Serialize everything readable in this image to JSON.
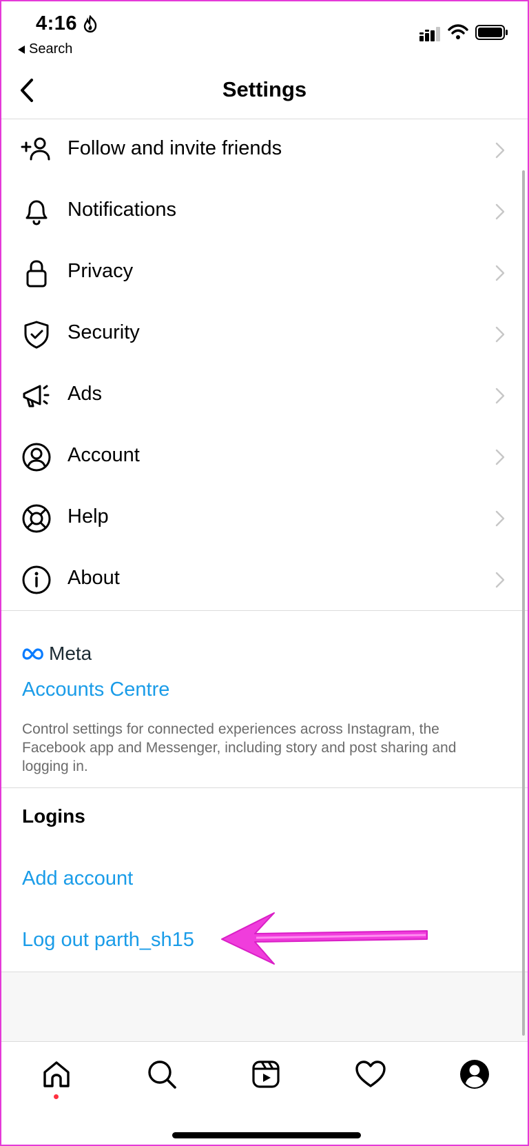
{
  "status_bar": {
    "time": "4:16",
    "back_app": "Search"
  },
  "header": {
    "title": "Settings"
  },
  "menu": [
    {
      "label": "Follow and invite friends",
      "icon": "add-person-icon"
    },
    {
      "label": "Notifications",
      "icon": "bell-icon"
    },
    {
      "label": "Privacy",
      "icon": "lock-icon"
    },
    {
      "label": "Security",
      "icon": "shield-check-icon"
    },
    {
      "label": "Ads",
      "icon": "megaphone-icon"
    },
    {
      "label": "Account",
      "icon": "account-circle-icon"
    },
    {
      "label": "Help",
      "icon": "lifebuoy-icon"
    },
    {
      "label": "About",
      "icon": "info-icon"
    }
  ],
  "meta": {
    "logo_text": "Meta",
    "accounts_centre": "Accounts Centre",
    "description": "Control settings for connected experiences across Instagram, the Facebook app and Messenger, including story and post sharing and logging in."
  },
  "logins": {
    "heading": "Logins",
    "add_account": "Add account",
    "logout": "Log out parth_sh15"
  },
  "tabbar": [
    "home",
    "search",
    "reels",
    "activity",
    "profile"
  ],
  "colors": {
    "link": "#1a9ce8",
    "annotation_arrow": "#ee2bd8",
    "frame": "#e43ad8",
    "notification_dot": "#ff3040"
  }
}
